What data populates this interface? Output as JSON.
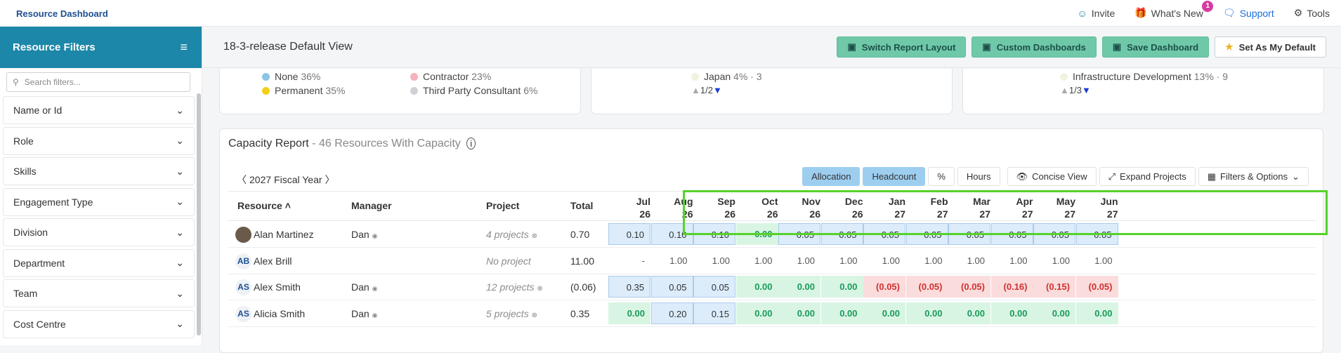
{
  "app": {
    "title": "Resource Dashboard"
  },
  "topnav": {
    "invite": "Invite",
    "whats_new": "What's New",
    "whats_new_badge": "1",
    "support": "Support",
    "tools": "Tools"
  },
  "sidebar": {
    "title": "Resource Filters",
    "search_placeholder": "Search filters...",
    "items": [
      {
        "label": "Name or Id"
      },
      {
        "label": "Role"
      },
      {
        "label": "Skills"
      },
      {
        "label": "Engagement Type"
      },
      {
        "label": "Division"
      },
      {
        "label": "Department"
      },
      {
        "label": "Team"
      },
      {
        "label": "Cost Centre"
      }
    ]
  },
  "header": {
    "title": "18-3-release Default View",
    "buttons": {
      "switch_layout": "Switch Report Layout",
      "custom_dashboards": "Custom Dashboards",
      "save_dashboard": "Save Dashboard",
      "set_default": "Set As My Default"
    }
  },
  "cards": {
    "c1": {
      "none": "None",
      "none_pct": "36%",
      "permanent": "Permanent",
      "permanent_pct": "35%",
      "contractor": "Contractor",
      "contractor_pct": "23%",
      "tpc": "Third Party Consultant",
      "tpc_pct": "6%"
    },
    "c2": {
      "japan": "Japan",
      "japan_meta": "4% · 3",
      "pager": "1/2"
    },
    "c3": {
      "infra": "Infrastructure Development",
      "infra_meta": "13% · 9",
      "pager": "1/3"
    }
  },
  "capacity": {
    "title": "Capacity Report",
    "subtitle": "- 46 Resources With Capacity",
    "fiscal_year": "2027 Fiscal Year",
    "toggles": {
      "allocation": "Allocation",
      "headcount": "Headcount",
      "percent": "%",
      "hours": "Hours"
    },
    "tools": {
      "concise": "Concise View",
      "expand": "Expand Projects",
      "filters": "Filters & Options"
    },
    "columns": {
      "resource": "Resource",
      "manager": "Manager",
      "project": "Project",
      "total": "Total"
    },
    "months": [
      {
        "m": "Jul",
        "y": "26"
      },
      {
        "m": "Aug",
        "y": "26"
      },
      {
        "m": "Sep",
        "y": "26"
      },
      {
        "m": "Oct",
        "y": "26"
      },
      {
        "m": "Nov",
        "y": "26"
      },
      {
        "m": "Dec",
        "y": "26"
      },
      {
        "m": "Jan",
        "y": "27"
      },
      {
        "m": "Feb",
        "y": "27"
      },
      {
        "m": "Mar",
        "y": "27"
      },
      {
        "m": "Apr",
        "y": "27"
      },
      {
        "m": "May",
        "y": "27"
      },
      {
        "m": "Jun",
        "y": "27"
      }
    ],
    "rows": [
      {
        "initials": "",
        "name": "Alan Martinez",
        "manager": "Dan",
        "project": "4 projects",
        "total": "0.70",
        "values": [
          "0.10",
          "0.10",
          "0.10",
          "0.00",
          "0.05",
          "0.05",
          "0.05",
          "0.05",
          "0.05",
          "0.05",
          "0.05",
          "0.05"
        ],
        "styles": [
          "b",
          "b",
          "b",
          "g",
          "b",
          "b",
          "b",
          "b",
          "b",
          "b",
          "b",
          "b"
        ]
      },
      {
        "initials": "AB",
        "name": "Alex Brill",
        "manager": "",
        "project": "No project",
        "total": "11.00",
        "values": [
          "-",
          "1.00",
          "1.00",
          "1.00",
          "1.00",
          "1.00",
          "1.00",
          "1.00",
          "1.00",
          "1.00",
          "1.00",
          "1.00"
        ],
        "styles": [
          "p",
          "p",
          "p",
          "p",
          "p",
          "p",
          "p",
          "p",
          "p",
          "p",
          "p",
          "p"
        ]
      },
      {
        "initials": "AS",
        "name": "Alex Smith",
        "manager": "Dan",
        "project": "12 projects",
        "total": "(0.06)",
        "values": [
          "0.35",
          "0.05",
          "0.05",
          "0.00",
          "0.00",
          "0.00",
          "(0.05)",
          "(0.05)",
          "(0.05)",
          "(0.16)",
          "(0.15)",
          "(0.05)"
        ],
        "styles": [
          "b",
          "b",
          "b",
          "g",
          "g",
          "g",
          "r",
          "r",
          "r",
          "r",
          "r",
          "r"
        ]
      },
      {
        "initials": "AS",
        "name": "Alicia Smith",
        "manager": "Dan",
        "project": "5 projects",
        "total": "0.35",
        "values": [
          "0.00",
          "0.20",
          "0.15",
          "0.00",
          "0.00",
          "0.00",
          "0.00",
          "0.00",
          "0.00",
          "0.00",
          "0.00",
          "0.00"
        ],
        "styles": [
          "g",
          "b",
          "b",
          "g",
          "g",
          "g",
          "g",
          "g",
          "g",
          "g",
          "g",
          "g"
        ]
      }
    ]
  }
}
